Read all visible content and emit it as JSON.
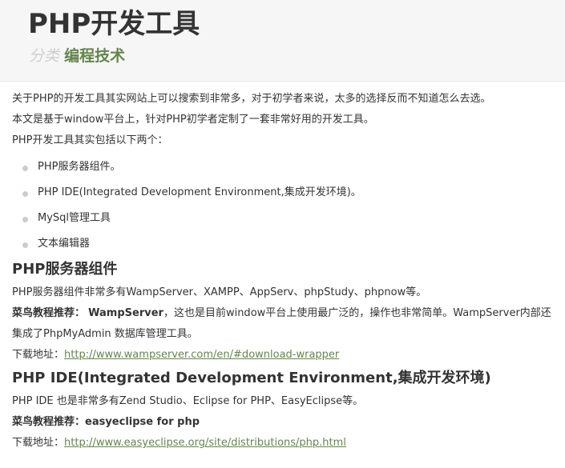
{
  "header": {
    "title": "PHP开发工具",
    "category_label": "分类",
    "category_value": "编程技术"
  },
  "intro": [
    "关于PHP的开发工具其实网站上可以搜索到非常多，对于初学者来说，太多的选择反而不知道怎么去选。",
    "本文是基于window平台上，针对PHP初学者定制了一套非常好用的开发工具。",
    "PHP开发工具其实包括以下两个："
  ],
  "list_items": [
    "PHP服务器组件。",
    "PHP IDE(Integrated Development Environment,集成开发环境)。",
    "MySql管理工具",
    "文本编辑器"
  ],
  "section1": {
    "heading": "PHP服务器组件",
    "para1": "PHP服务器组件非常多有WampServer、XAMPP、AppServ、phpStudy、phpnow等。",
    "rec_label": "菜鸟教程推荐：",
    "rec_name": "WampServer",
    "rec_text": "，这也是目前window平台上使用最广泛的，操作也非常简单。WampServer内部还集成了PhpMyAdmin 数据库管理工具。",
    "download_label": "下载地址：",
    "download_url": "http://www.wampserver.com/en/#download-wrapper"
  },
  "section2": {
    "heading": "PHP IDE(Integrated Development Environment,集成开发环境)",
    "para1": "PHP IDE 也是非常多有Zend Studio、Eclipse for PHP、EasyEclipse等。",
    "rec_label": "菜鸟教程推荐：easyeclipse for php",
    "download_label": "下载地址：",
    "download_url": "http://www.easyeclipse.org/site/distributions/php.html"
  },
  "colors": {
    "accent": "#64854c",
    "category_label": "#cfcfcf",
    "text": "#333333",
    "header_bg": "#f6f6f6",
    "bullet": "#cccccc"
  }
}
